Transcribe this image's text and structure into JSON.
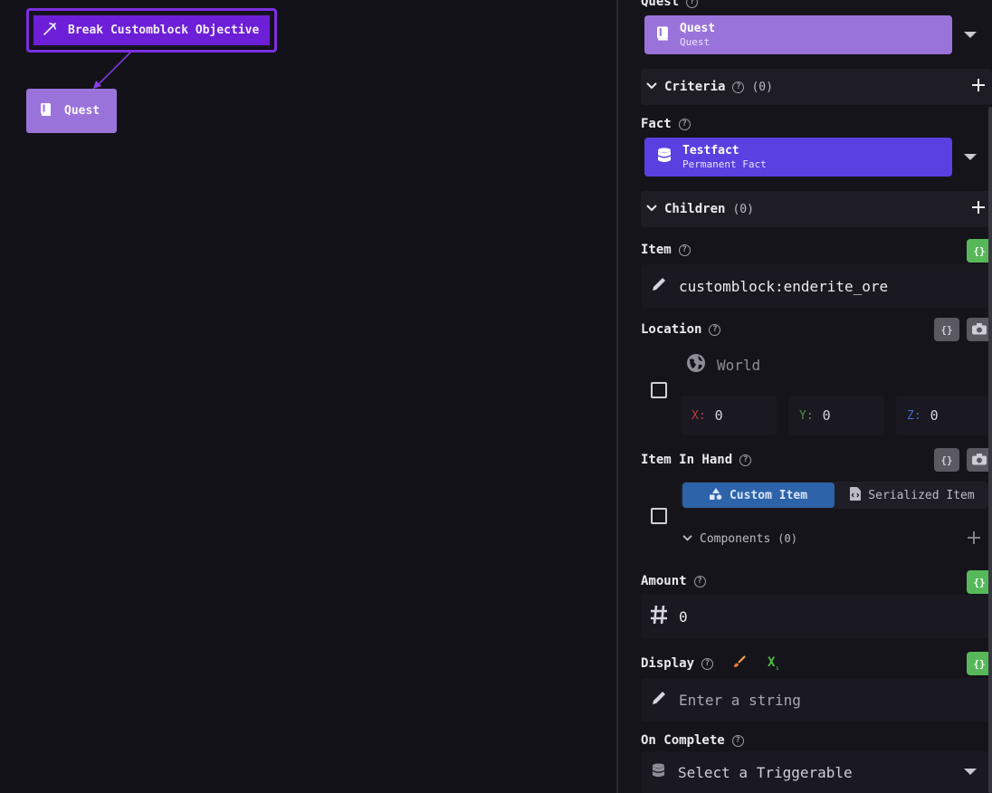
{
  "canvas": {
    "objective_node": {
      "label": "Break Customblock Objective",
      "icon": "pickaxe-icon"
    },
    "quest_node": {
      "label": "Quest",
      "icon": "book-icon"
    }
  },
  "panel": {
    "quest": {
      "label": "Quest",
      "card_title": "Quest",
      "card_subtitle": "Quest",
      "card_color": "#9a73da"
    },
    "criteria": {
      "label": "Criteria",
      "count": "(0)"
    },
    "fact": {
      "label": "Fact",
      "card_title": "Testfact",
      "card_subtitle": "Permanent Fact",
      "card_color": "#5a40e0"
    },
    "children": {
      "label": "Children",
      "count": "(0)"
    },
    "item": {
      "label": "Item",
      "value": "customblock:enderite_ore",
      "json_label": "{}"
    },
    "location": {
      "label": "Location",
      "world_placeholder": "World",
      "x_label": "X:",
      "x_value": "0",
      "y_label": "Y:",
      "y_value": "0",
      "z_label": "Z:",
      "z_value": "0",
      "json_label": "{}"
    },
    "item_in_hand": {
      "label": "Item In Hand",
      "tab_custom": "Custom Item",
      "tab_serialized": "Serialized Item",
      "components_label": "Components",
      "components_count": "(0)",
      "json_label": "{}"
    },
    "amount": {
      "label": "Amount",
      "value": "0",
      "json_label": "{}"
    },
    "display": {
      "label": "Display",
      "placeholder": "Enter a string",
      "json_label": "{}"
    },
    "on_complete": {
      "label": "On Complete",
      "placeholder": "Select a Triggerable"
    }
  },
  "colors": {
    "accent_purple": "#6c1fd6",
    "json_green": "#57b85a",
    "tab_active_blue": "#2d63a8"
  }
}
